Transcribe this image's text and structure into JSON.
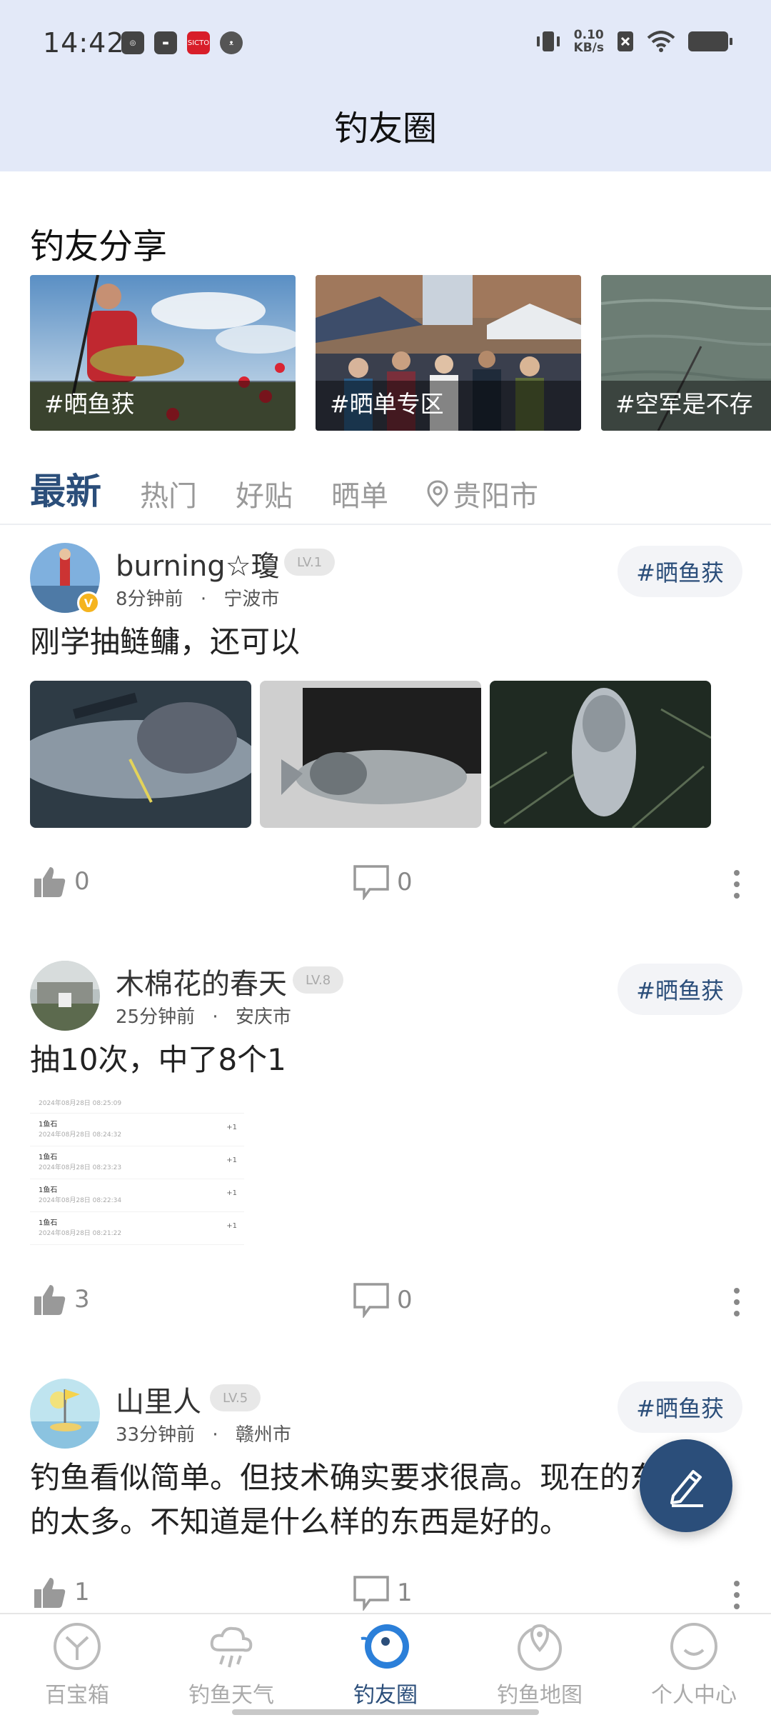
{
  "status_bar": {
    "time": "14:42",
    "net_speed_value": "0.10",
    "net_speed_unit": "KB/s",
    "app_badge": "SICTO"
  },
  "header": {
    "title": "钓友圈"
  },
  "share": {
    "title": "钓友分享",
    "cards": [
      {
        "label": "#晒鱼获"
      },
      {
        "label": "#晒单专区"
      },
      {
        "label": "#空军是不存"
      }
    ]
  },
  "tabs": {
    "latest": "最新",
    "hot": "热门",
    "good": "好贴",
    "orders": "晒单",
    "location": "贵阳市"
  },
  "posts": [
    {
      "user": "burning☆瓊",
      "level": "LV.1",
      "time": "8分钟前",
      "dot": "·",
      "city": "宁波市",
      "tag": "#晒鱼获",
      "content": "刚学抽鲢鳙，还可以",
      "likes": "0",
      "comments": "0",
      "verified": "V"
    },
    {
      "user": "木棉花的春天",
      "level": "LV.8",
      "time": "25分钟前",
      "dot": "·",
      "city": "安庆市",
      "tag": "#晒鱼获",
      "content": "抽10次，中了8个1",
      "likes": "3",
      "comments": "0",
      "records": [
        {
          "title": "",
          "date": "2024年08月28日 08:25:09",
          "value": ""
        },
        {
          "title": "1鱼石",
          "date": "2024年08月28日 08:24:32",
          "value": "+1"
        },
        {
          "title": "1鱼石",
          "date": "2024年08月28日 08:23:23",
          "value": "+1"
        },
        {
          "title": "1鱼石",
          "date": "2024年08月28日 08:22:34",
          "value": "+1"
        },
        {
          "title": "1鱼石",
          "date": "2024年08月28日 08:21:22",
          "value": "+1"
        }
      ]
    },
    {
      "user": "山里人",
      "level": "LV.5",
      "time": "33分钟前",
      "dot": "·",
      "city": "赣州市",
      "tag": "#晒鱼获",
      "content": "钓鱼看似简单。但技术确实要求很高。现在的东西吹的太多。不知道是什么样的东西是好的。",
      "likes": "1",
      "comments": "1"
    }
  ],
  "bottom_nav": [
    {
      "label": "百宝箱",
      "icon": "treasure-box-icon"
    },
    {
      "label": "钓鱼天气",
      "icon": "weather-icon"
    },
    {
      "label": "钓友圈",
      "icon": "fish-circle-icon",
      "active": true
    },
    {
      "label": "钓鱼地图",
      "icon": "map-pin-icon"
    },
    {
      "label": "个人中心",
      "icon": "profile-icon"
    }
  ],
  "colors": {
    "header_bg": "#e3e9f8",
    "accent": "#2b4e7a",
    "muted": "#999999",
    "badge_gold": "#f5b41f"
  }
}
